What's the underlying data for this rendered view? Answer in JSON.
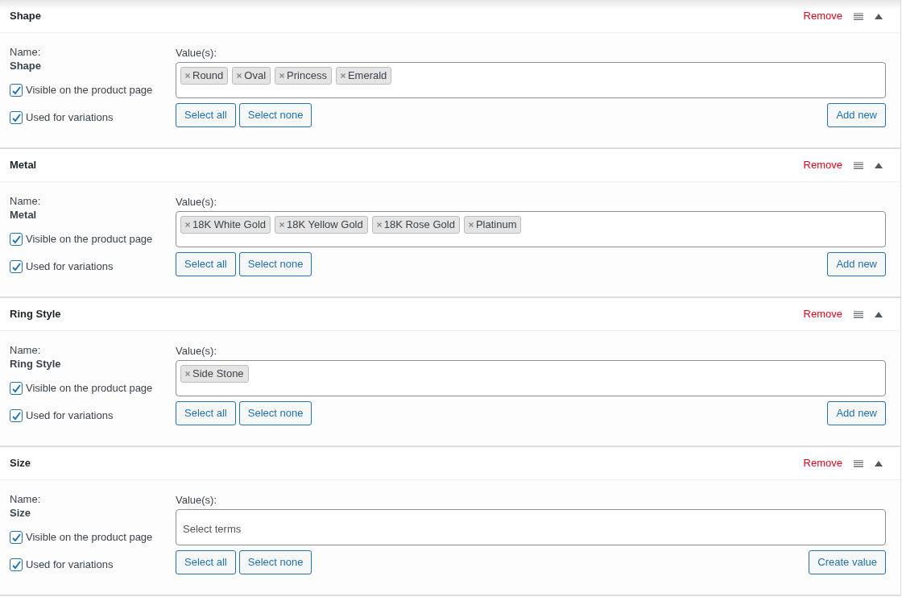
{
  "attributes": [
    {
      "title": "Shape",
      "remove_label": "Remove",
      "name_label": "Name:",
      "name": "Shape",
      "options": [
        {
          "label": "Visible on the product page",
          "checked": true
        },
        {
          "label": "Used for variations",
          "checked": true
        }
      ],
      "values_label": "Value(s):",
      "values": [
        "Round",
        "Oval",
        "Princess",
        "Emerald"
      ],
      "select_all": "Select all",
      "select_none": "Select none",
      "add_label": "Add new",
      "expanded": true
    },
    {
      "title": "Metal",
      "remove_label": "Remove",
      "name_label": "Name:",
      "name": "Metal",
      "options": [
        {
          "label": "Visible on the product page",
          "checked": true
        },
        {
          "label": "Used for variations",
          "checked": true
        }
      ],
      "values_label": "Value(s):",
      "values": [
        "18K White Gold",
        "18K Yellow Gold",
        "18K Rose Gold",
        "Platinum"
      ],
      "select_all": "Select all",
      "select_none": "Select none",
      "add_label": "Add new",
      "expanded": true
    },
    {
      "title": "Ring Style",
      "remove_label": "Remove",
      "name_label": "Name:",
      "name": "Ring Style",
      "options": [
        {
          "label": "Visible on the product page",
          "checked": true
        },
        {
          "label": "Used for variations",
          "checked": true
        }
      ],
      "values_label": "Value(s):",
      "values": [
        "Side Stone"
      ],
      "select_all": "Select all",
      "select_none": "Select none",
      "add_label": "Add new",
      "expanded": true
    },
    {
      "title": "Size",
      "remove_label": "Remove",
      "name_label": "Name:",
      "name": "Size",
      "options": [
        {
          "label": "Visible on the product page",
          "checked": true
        },
        {
          "label": "Used for variations",
          "checked": true
        }
      ],
      "values_label": "Value(s):",
      "placeholder": "Select terms",
      "select_all": "Select all",
      "select_none": "Select none",
      "add_label": "Create value",
      "expanded": true
    }
  ]
}
